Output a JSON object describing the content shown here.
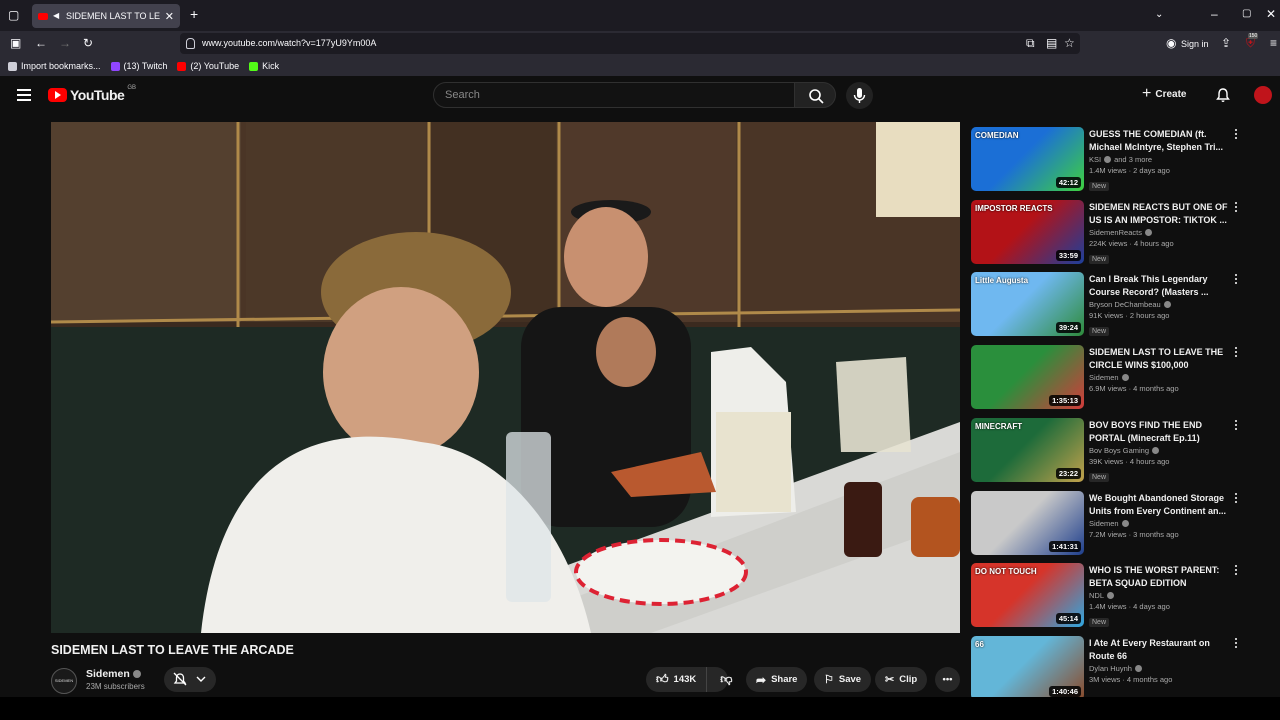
{
  "browser": {
    "tab_title": "SIDEMEN LAST TO LEAVE THE ARCADE",
    "url": "www.youtube.com/watch?v=177yU9Ym00A",
    "sign_in": "Sign in",
    "badge_count": "150",
    "bookmarks": [
      {
        "label": "Import bookmarks...",
        "icon": "folder-icon",
        "color": "#cfcfd8"
      },
      {
        "label": "(13) Twitch",
        "icon": "twitch-icon",
        "color": "#9146ff"
      },
      {
        "label": "(2) YouTube",
        "icon": "youtube-icon",
        "color": "#ff0000"
      },
      {
        "label": "Kick",
        "icon": "kick-icon",
        "color": "#53fc18"
      }
    ]
  },
  "header": {
    "logo": "YouTube",
    "country": "GB",
    "search_placeholder": "Search",
    "create_label": "Create"
  },
  "video": {
    "title": "SIDEMEN LAST TO LEAVE THE ARCADE",
    "avatar_text": "SIDEMEN",
    "channel": "Sidemen",
    "subscribers": "23M subscribers",
    "likes": "143K",
    "share_label": "Share",
    "save_label": "Save",
    "clip_label": "Clip"
  },
  "recommendations": [
    {
      "title": "GUESS THE COMEDIAN (ft. Michael McIntyre, Stephen Tri...",
      "channel": "KSI",
      "channel_extra": "and 3 more",
      "views": "1.4M views · 2 days ago",
      "badge": "New",
      "duration": "42:12",
      "thumb_text": "COMEDIAN",
      "colors": [
        "#1b6fd6",
        "#3fd13f"
      ]
    },
    {
      "title": "SIDEMEN REACTS BUT ONE OF US IS AN IMPOSTOR: TIKTOK ...",
      "channel": "SidemenReacts",
      "channel_extra": "",
      "views": "224K views · 4 hours ago",
      "badge": "New",
      "duration": "33:59",
      "thumb_text": "IMPOSTOR REACTS",
      "colors": [
        "#b31217",
        "#1c3f9c"
      ]
    },
    {
      "title": "Can I Break This Legendary Course Record? (Masters ...",
      "channel": "Bryson DeChambeau",
      "channel_extra": "",
      "views": "91K views · 2 hours ago",
      "badge": "New",
      "duration": "39:24",
      "thumb_text": "Little Augusta",
      "colors": [
        "#6fb8f0",
        "#2e8b3a"
      ]
    },
    {
      "title": "SIDEMEN LAST TO LEAVE THE CIRCLE WINS $100,000",
      "channel": "Sidemen",
      "channel_extra": "",
      "views": "6.9M views · 4 months ago",
      "badge": "",
      "duration": "1:35:13",
      "thumb_text": "",
      "colors": [
        "#2a8f3c",
        "#d33b3b"
      ]
    },
    {
      "title": "BOV BOYS FIND THE END PORTAL (Minecraft Ep.11)",
      "channel": "Bov Boys Gaming",
      "channel_extra": "",
      "views": "39K views · 4 hours ago",
      "badge": "New",
      "duration": "23:22",
      "thumb_text": "MINECRAFT",
      "colors": [
        "#1d6b3a",
        "#c2a24c"
      ]
    },
    {
      "title": "We Bought Abandoned Storage Units from Every Continent an...",
      "channel": "Sidemen",
      "channel_extra": "",
      "views": "7.2M views · 3 months ago",
      "badge": "",
      "duration": "1:41:31",
      "thumb_text": "",
      "colors": [
        "#c9c9c9",
        "#1e3e8c"
      ]
    },
    {
      "title": "WHO IS THE WORST PARENT: BETA SQUAD EDITION",
      "channel": "NDL",
      "channel_extra": "",
      "views": "1.4M views · 4 days ago",
      "badge": "New",
      "duration": "45:14",
      "thumb_text": "DO NOT TOUCH",
      "colors": [
        "#d6342a",
        "#2fa7e0"
      ]
    },
    {
      "title": "I Ate At Every Restaurant on Route 66",
      "channel": "Dylan Huynh",
      "channel_extra": "",
      "views": "3M views · 4 months ago",
      "badge": "",
      "duration": "1:40:46",
      "thumb_text": "66",
      "colors": [
        "#63b6d8",
        "#8a4a2a"
      ]
    }
  ]
}
